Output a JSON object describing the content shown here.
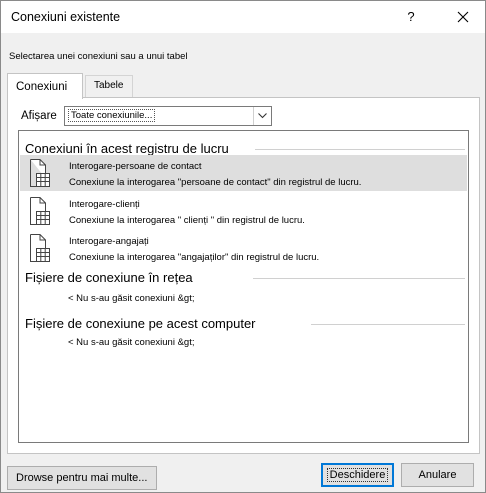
{
  "window": {
    "title": "Conexiuni existente",
    "help_glyph": "?",
    "instruction": "Selectarea unei conexiuni sau a unui tabel"
  },
  "tabs": [
    {
      "label": "Conexiuni",
      "active": true
    },
    {
      "label": "Tabele",
      "active": false
    }
  ],
  "show": {
    "label": "Afișare",
    "selected": "Toate conexiunile..."
  },
  "sections": {
    "workbook": {
      "title": "Conexiuni în acest registru de lucru",
      "items": [
        {
          "name": "Interogare-persoane de contact",
          "description": "Conexiune la interogarea \"persoane de contact\" din registrul de lucru.",
          "selected": true,
          "icon": "table-connection-icon"
        },
        {
          "name": "Interogare-clienți",
          "description": "Conexiune la interogarea \" clienți \" din registrul de lucru.",
          "selected": false,
          "icon": "table-connection-icon"
        },
        {
          "name": "Interogare-angajați",
          "description": "Conexiune la interogarea \"angajaților\" din registrul de lucru.",
          "selected": false,
          "icon": "table-connection-icon"
        }
      ]
    },
    "network": {
      "title": "Fișiere de conexiune în rețea",
      "empty": "< Nu s-au găsit conexiuni &gt;"
    },
    "computer": {
      "title": "Fișiere de conexiune pe acest computer",
      "empty": "< Nu s-au găsit conexiuni &gt;"
    }
  },
  "buttons": {
    "browse": "Drowse pentru mai multe...",
    "open": "Deschidere",
    "cancel": "Anulare"
  },
  "colors": {
    "accent": "#0078d7",
    "selected_row": "#dedede"
  }
}
